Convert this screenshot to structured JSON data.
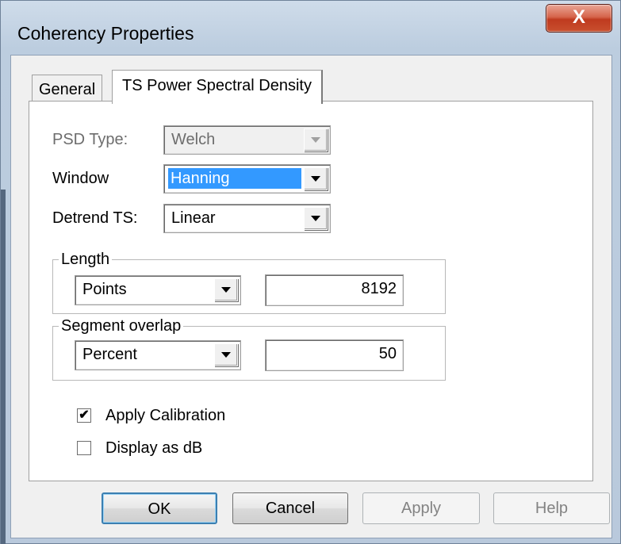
{
  "window": {
    "title": "Coherency Properties",
    "close_glyph": "X"
  },
  "tabs": [
    {
      "label": "General",
      "active": false
    },
    {
      "label": "TS Power Spectral Density",
      "active": true
    }
  ],
  "psd": {
    "psd_type": {
      "label": "PSD Type:",
      "value": "Welch",
      "enabled": false
    },
    "window_fn": {
      "label": "Window",
      "value": "Hanning",
      "selected": true
    },
    "detrend": {
      "label": "Detrend TS:",
      "value": "Linear"
    }
  },
  "length": {
    "group_label": "Length",
    "unit": "Points",
    "value": "8192"
  },
  "overlap": {
    "group_label": "Segment overlap",
    "unit": "Percent",
    "value": "50"
  },
  "options": {
    "apply_calibration": {
      "label": "Apply Calibration",
      "checked": true,
      "mark": "✔"
    },
    "display_db": {
      "label": "Display as dB",
      "checked": false,
      "mark": ""
    }
  },
  "buttons": {
    "ok": "OK",
    "cancel": "Cancel",
    "apply": "Apply",
    "help": "Help"
  },
  "colors": {
    "selection": "#3399ff",
    "close_button": "#c9502f"
  }
}
